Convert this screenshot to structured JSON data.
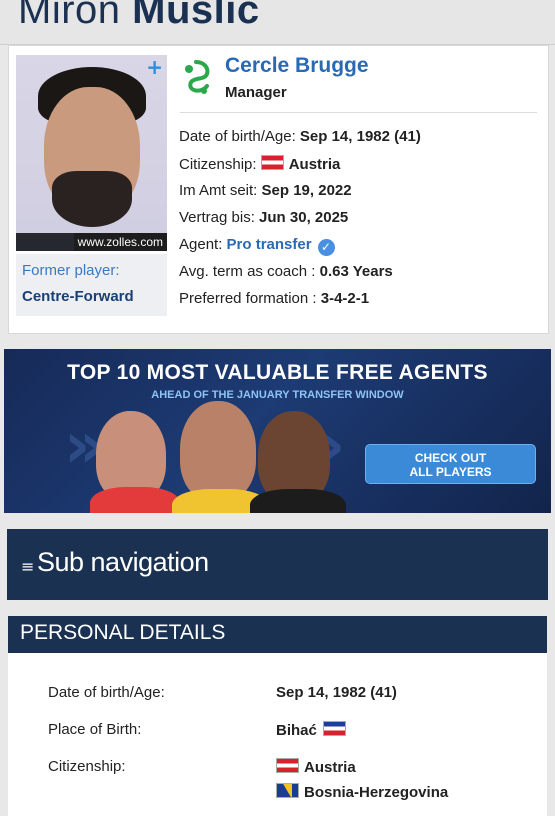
{
  "header": {
    "first_name": "Miron",
    "last_name": "Muslic"
  },
  "profile": {
    "photo_credit": "www.zolles.com",
    "former_label": "Former player:",
    "former_position": "Centre-Forward",
    "club": "Cercle Brugge",
    "role": "Manager",
    "dob_label": "Date of birth/Age:",
    "dob_value": "Sep 14, 1982 (41)",
    "citizenship_label": "Citizenship:",
    "citizenship_value": "Austria",
    "in_office_label": "Im Amt seit:",
    "in_office_value": "Sep 19, 2022",
    "contract_label": "Vertrag bis:",
    "contract_value": "Jun 30, 2025",
    "agent_label": "Agent:",
    "agent_value": "Pro transfer",
    "avg_term_label": "Avg. term as coach :",
    "avg_term_value": "0.63 Years",
    "formation_label": "Preferred formation :",
    "formation_value": "3-4-2-1"
  },
  "banner": {
    "title": "TOP 10 MOST VALUABLE FREE AGENTS",
    "subtitle": "AHEAD OF THE JANUARY TRANSFER WINDOW",
    "cta_line1": "CHECK OUT",
    "cta_line2": "ALL PLAYERS"
  },
  "subnav": {
    "label": "Sub navigation"
  },
  "personal": {
    "title": "PERSONAL DETAILS",
    "dob_label": "Date of birth/Age:",
    "dob_value": "Sep 14, 1982 (41)",
    "pob_label": "Place of Birth:",
    "pob_value": "Bihać",
    "citizenship_label": "Citizenship:",
    "citizenship_1": "Austria",
    "citizenship_2": "Bosnia-Herzegovina"
  },
  "colors": {
    "navy": "#1a3151",
    "link": "#2a6ab4",
    "accent": "#3b8ad8"
  }
}
